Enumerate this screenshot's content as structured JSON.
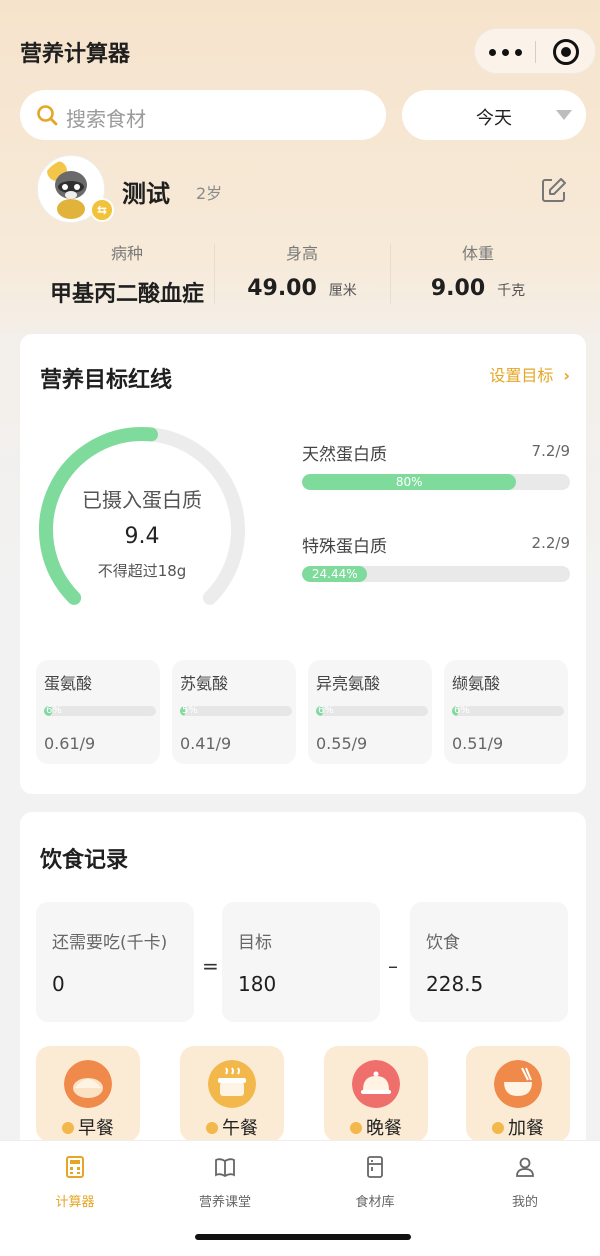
{
  "app": {
    "title": "营养计算器"
  },
  "search": {
    "placeholder": "搜索食材"
  },
  "date_select": {
    "value": "今天"
  },
  "profile": {
    "name": "测试",
    "age": "2岁"
  },
  "stats": [
    {
      "label": "病种",
      "value": "甲基丙二酸血症",
      "unit": ""
    },
    {
      "label": "身高",
      "value": "49.00",
      "unit": "厘米"
    },
    {
      "label": "体重",
      "value": "9.00",
      "unit": "千克"
    }
  ],
  "nutrition": {
    "title": "营养目标红线",
    "set_target": "设置目标",
    "gauge": {
      "label": "已摄入蛋白质",
      "value": "9.4",
      "note": "不得超过18g",
      "fraction": 0.52
    },
    "proteins": [
      {
        "name": "天然蛋白质",
        "ratio": "7.2/9",
        "percent_label": "80%",
        "percent": 80
      },
      {
        "name": "特殊蛋白质",
        "ratio": "2.2/9",
        "percent_label": "24.44%",
        "percent": 24.44
      }
    ],
    "amino_acids": [
      {
        "name": "蛋氨酸",
        "value": "0.61/9",
        "percent_label": "6%",
        "percent": 6.8
      },
      {
        "name": "苏氨酸",
        "value": "0.41/9",
        "percent_label": "5%",
        "percent": 4.6
      },
      {
        "name": "异亮氨酸",
        "value": "0.55/9",
        "percent_label": "6%",
        "percent": 6.1
      },
      {
        "name": "缬氨酸",
        "value": "0.51/9",
        "percent_label": "6%",
        "percent": 5.7
      }
    ]
  },
  "diet": {
    "title": "饮食记录",
    "boxes": [
      {
        "label": "还需要吃(千卡)",
        "value": "0"
      },
      {
        "label": "目标",
        "value": "180"
      },
      {
        "label": "饮食",
        "value": "228.5"
      }
    ],
    "ops": [
      "=",
      "–"
    ],
    "meals": [
      {
        "label": "早餐",
        "icon": "bun-icon",
        "color": "#f08a4b"
      },
      {
        "label": "午餐",
        "icon": "pot-icon",
        "color": "#f2b84b"
      },
      {
        "label": "晚餐",
        "icon": "cloche-icon",
        "color": "#ef6f6c"
      },
      {
        "label": "加餐",
        "icon": "bowl-icon",
        "color": "#f08a4b"
      }
    ]
  },
  "tabs": [
    {
      "label": "计算器",
      "icon": "calculator-icon",
      "active": true
    },
    {
      "label": "营养课堂",
      "icon": "book-icon",
      "active": false
    },
    {
      "label": "食材库",
      "icon": "fridge-icon",
      "active": false
    },
    {
      "label": "我的",
      "icon": "user-icon",
      "active": false
    }
  ],
  "colors": {
    "accent": "#e6a625",
    "progress": "#7fdb9c",
    "track": "#e9e9e9"
  }
}
